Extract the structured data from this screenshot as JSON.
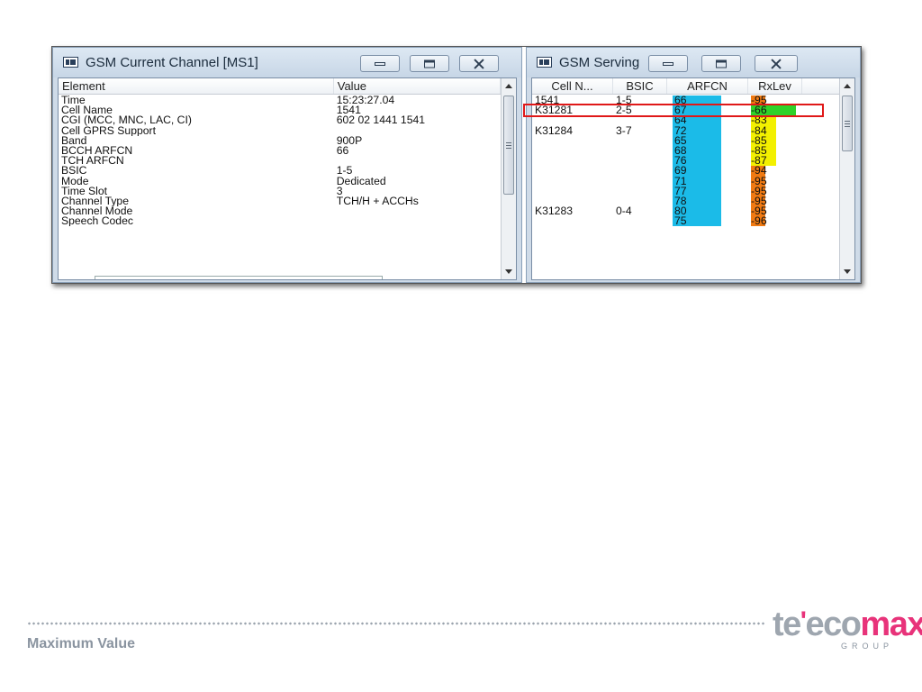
{
  "left_window": {
    "title": "GSM Current Channel [MS1]",
    "columns": [
      "Element",
      "Value"
    ],
    "rows": [
      {
        "element": "Time",
        "value": "15:23:27.04"
      },
      {
        "element": "Cell Name",
        "value": "1541"
      },
      {
        "element": "CGI (MCC, MNC, LAC, CI)",
        "value": "602 02 1441 1541"
      },
      {
        "element": "Cell GPRS Support",
        "value": ""
      },
      {
        "element": "Band",
        "value": "900P"
      },
      {
        "element": "BCCH ARFCN",
        "value": "66"
      },
      {
        "element": "TCH ARFCN",
        "value": ""
      },
      {
        "element": "BSIC",
        "value": "1-5"
      },
      {
        "element": "Mode",
        "value": "Dedicated"
      },
      {
        "element": "Time Slot",
        "value": "3"
      },
      {
        "element": "Channel Type",
        "value": "TCH/H + ACCHs"
      },
      {
        "element": "Channel Mode",
        "value": ""
      },
      {
        "element": "Speech Codec",
        "value": ""
      }
    ]
  },
  "right_window": {
    "title": "GSM Serving ...",
    "columns": [
      "Cell N...",
      "BSIC",
      "ARFCN",
      "RxLev"
    ],
    "rows": [
      {
        "cell": "1541",
        "bsic": "1-5",
        "arfcn": "66",
        "rxlev": "-95",
        "rxlev_color": "orange"
      },
      {
        "cell": "K31281",
        "bsic": "2-5",
        "arfcn": "67",
        "rxlev": "-66",
        "rxlev_color": "green"
      },
      {
        "cell": "",
        "bsic": "",
        "arfcn": "64",
        "rxlev": "-83",
        "rxlev_color": "yellow"
      },
      {
        "cell": "K31284",
        "bsic": "3-7",
        "arfcn": "72",
        "rxlev": "-84",
        "rxlev_color": "yellow"
      },
      {
        "cell": "",
        "bsic": "",
        "arfcn": "65",
        "rxlev": "-85",
        "rxlev_color": "yellow"
      },
      {
        "cell": "",
        "bsic": "",
        "arfcn": "68",
        "rxlev": "-85",
        "rxlev_color": "yellow"
      },
      {
        "cell": "",
        "bsic": "",
        "arfcn": "76",
        "rxlev": "-87",
        "rxlev_color": "yellow"
      },
      {
        "cell": "",
        "bsic": "",
        "arfcn": "69",
        "rxlev": "-94",
        "rxlev_color": "orange"
      },
      {
        "cell": "",
        "bsic": "",
        "arfcn": "71",
        "rxlev": "-95",
        "rxlev_color": "orange"
      },
      {
        "cell": "",
        "bsic": "",
        "arfcn": "77",
        "rxlev": "-95",
        "rxlev_color": "orange"
      },
      {
        "cell": "",
        "bsic": "",
        "arfcn": "78",
        "rxlev": "-95",
        "rxlev_color": "orange"
      },
      {
        "cell": "K31283",
        "bsic": "0-4",
        "arfcn": "80",
        "rxlev": "-95",
        "rxlev_color": "orange"
      },
      {
        "cell": "",
        "bsic": "",
        "arfcn": "75",
        "rxlev": "-96",
        "rxlev_color": "orange"
      }
    ],
    "highlighted_row": 1
  },
  "colors": {
    "arfcn": "#1bbbe8",
    "orange": "#f07a12",
    "yellow": "#f3f000",
    "green": "#2ed229",
    "highlight": "#e01818"
  },
  "footer": {
    "caption": "Maximum Value",
    "logo_part1": "te",
    "logo_part2": "eco",
    "logo_part3": "max",
    "logo_sub": "GROUP"
  }
}
